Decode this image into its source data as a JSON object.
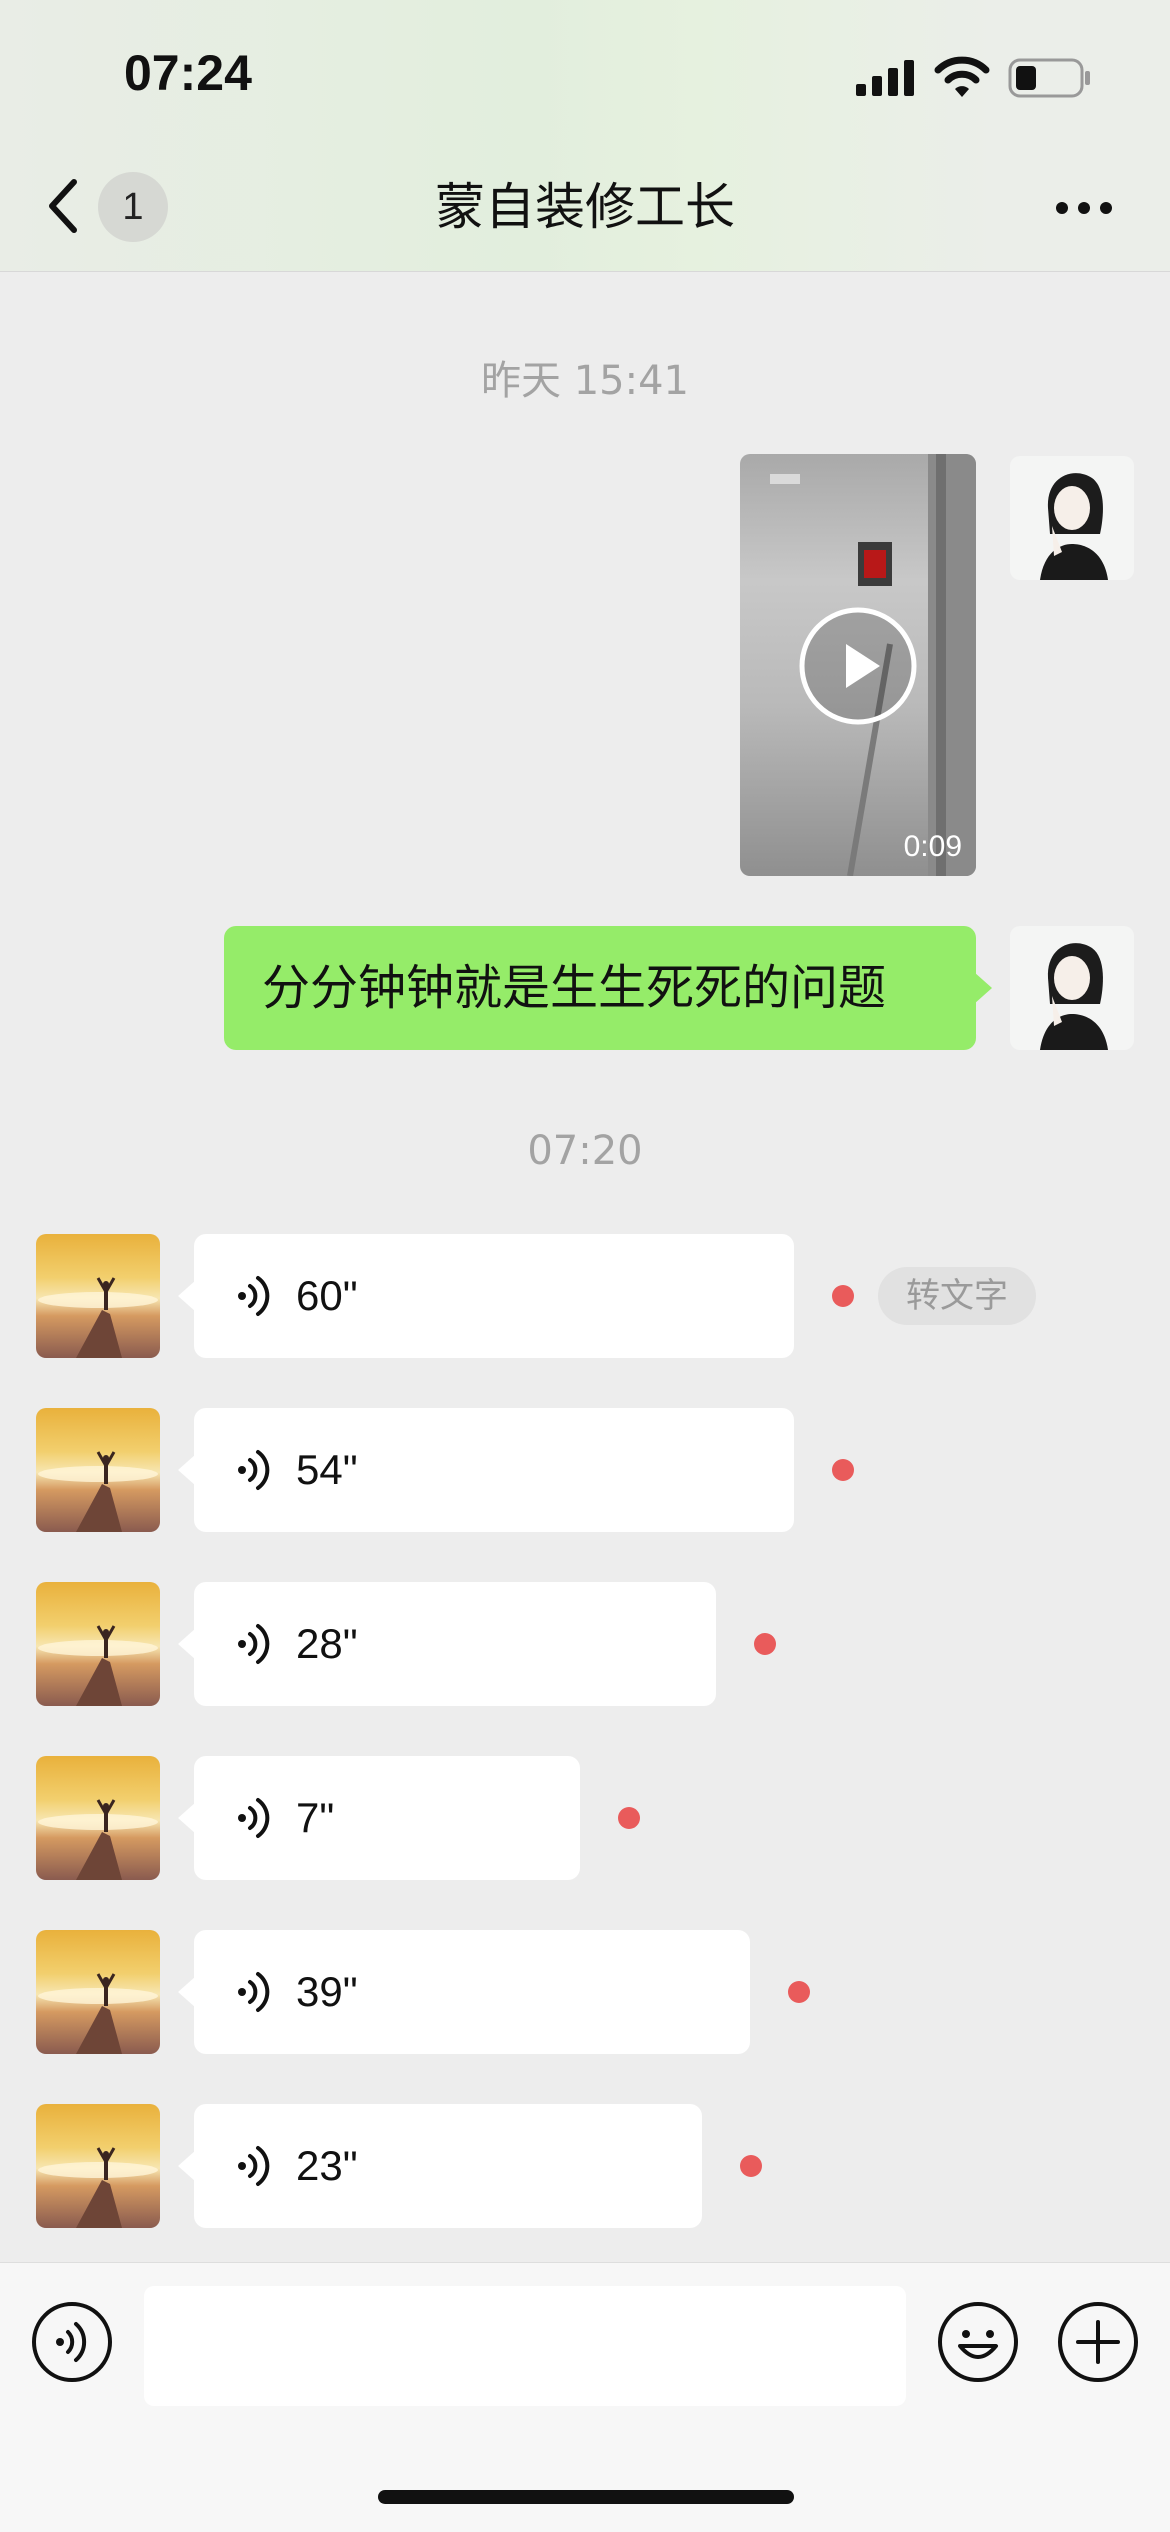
{
  "status_bar": {
    "time": "07:24"
  },
  "nav": {
    "unread_count": "1",
    "title": "蒙自装修工长"
  },
  "messages": {
    "timestamp_1": "昨天 15:41",
    "video_duration": "0:09",
    "sent_text": "分分钟钟就是生生死死的问题",
    "timestamp_2": "07:20",
    "voice": [
      {
        "duration": "60\""
      },
      {
        "duration": "54\""
      },
      {
        "duration": "28\""
      },
      {
        "duration": "7\""
      },
      {
        "duration": "39\""
      },
      {
        "duration": "23\""
      }
    ],
    "to_text_label": "转文字"
  },
  "colors": {
    "sent_bubble": "#95ec69",
    "unread_dot": "#e95b5b",
    "background": "#ededed"
  },
  "icons": [
    "back-chevron-icon",
    "more-dots-icon",
    "play-icon",
    "voice-wave-icon",
    "emoji-icon",
    "plus-icon"
  ]
}
